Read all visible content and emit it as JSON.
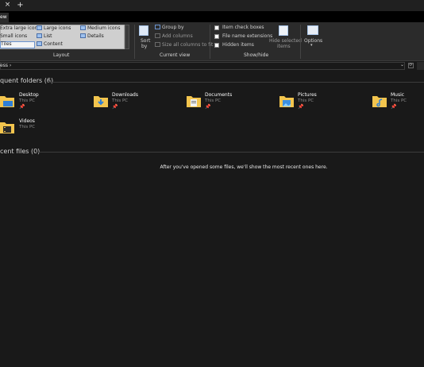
{
  "tabs": {
    "close_glyph": "×",
    "add_glyph": "+"
  },
  "ribbon": {
    "active_tab": "ew",
    "layout": {
      "items": [
        "Extra large icons",
        "Large icons",
        "Medium icons",
        "Small icons",
        "List",
        "Details",
        "Tiles",
        "Content"
      ],
      "group_label": "Layout"
    },
    "current_view": {
      "sort_label": "Sort",
      "sort_label2": "by",
      "group_by": "Group by",
      "add_columns": "Add columns",
      "size_columns": "Size all columns to fit",
      "group_label": "Current view"
    },
    "show_hide": {
      "item_check_boxes": "Item check boxes",
      "file_name_extensions": "File name extensions",
      "hidden_items": "Hidden items",
      "hide_selected_1": "Hide selected",
      "hide_selected_2": "items",
      "group_label": "Show/hide"
    },
    "options_label": "Options",
    "options_caret": "▾"
  },
  "address": {
    "crumb": "ess",
    "chevron": "›",
    "dropdown": "⌄",
    "refresh": "⟳"
  },
  "frequent": {
    "title": "quent folders (6)",
    "folders": [
      {
        "name": "Desktop",
        "location": "This PC",
        "pinned": "📌"
      },
      {
        "name": "Downloads",
        "location": "This PC",
        "pinned": "📌"
      },
      {
        "name": "Documents",
        "location": "This PC",
        "pinned": "📌"
      },
      {
        "name": "Pictures",
        "location": "This PC",
        "pinned": "📌"
      },
      {
        "name": "Music",
        "location": "This PC",
        "pinned": "📌"
      },
      {
        "name": "Videos",
        "location": "This PC",
        "pinned": ""
      }
    ]
  },
  "recent": {
    "title": "cent files (0)",
    "empty_message": "After you've opened some files, we'll show the most recent ones here."
  },
  "colors": {
    "background": "#191919",
    "ribbon": "#2b2b2b",
    "folder": "#f3c54e",
    "accent": "#2f7fd6"
  }
}
